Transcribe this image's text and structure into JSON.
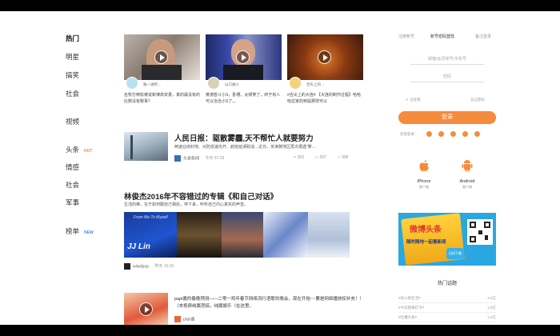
{
  "nav": {
    "items": [
      {
        "label": "热门",
        "tag": ""
      },
      {
        "label": "明星",
        "tag": ""
      },
      {
        "label": "搞笑",
        "tag": ""
      },
      {
        "label": "社会",
        "tag": ""
      },
      {
        "label": "视频",
        "tag": ""
      },
      {
        "label": "头条",
        "tag": "HOT"
      },
      {
        "label": "情感",
        "tag": ""
      },
      {
        "label": "社会",
        "tag": ""
      },
      {
        "label": "军事",
        "tag": ""
      },
      {
        "label": "榜单",
        "tag": "NEW"
      }
    ]
  },
  "videos": [
    {
      "author": "独一进积…",
      "title": "名牧打倒松被说新律高安書，真的最没有的比数没有致事？"
    },
    {
      "author": "山口通人",
      "title": "黄渤智斗小S，卧槽，太频笑了，终于有人可以治治小S了。。"
    },
    {
      "author": "舌尖上的…",
      "title": "#舌尖上的大连# 【大连的制作过程】哈哈哈拉家的到鼠那样可以"
    }
  ],
  "article1": {
    "title": "人民日报：驱散雾霾,天不帮忙人就要努力",
    "sub": "两速业绩封地、对防低速先开、航班延误取消…近日，京津冀地区再次遭遇“雾…",
    "source": "头条新闻",
    "time": "今天 07:29",
    "stats": [
      "359",
      "397",
      "998"
    ]
  },
  "article2": {
    "title": "林俊杰2016年不容错过的专辑《和自己对话》",
    "sub": "生活的难，在于如何跟自己相处，停下来，听听自己内心真实的声音。",
    "banner_text": "From Me To Myself",
    "banner_name": "JJ Lin",
    "source": "wilwilpop",
    "time": "昨天 16:33"
  },
  "article3": {
    "title": "papi酱的春晚预测——二零一鸡年春节网络流行语联欢晚会，现在开始~~要是网络播放权补充！！（本视频纯属恶搞，纯属娱乐（在这里。",
    "source": "papi酱"
  },
  "login": {
    "tabs": [
      "注册账号",
      "账号密码登陆",
      "备注登录"
    ],
    "username_placeholder": "邮箱/会员账号/手机号",
    "password_placeholder": "密码",
    "remember": "记住我",
    "forgot": "忘记密码",
    "button": "登录",
    "other_label": "其他登录："
  },
  "apps": [
    {
      "name": "iPhone",
      "sub": "客户端"
    },
    {
      "name": "Android",
      "sub": "客户端"
    }
  ],
  "ad": {
    "title": "微博头条",
    "line2": "随时随地一起看新闻",
    "qr_caption": "扫码下载"
  },
  "hot": {
    "title": "热门话题",
    "rows": [
      {
        "label": "#孙心悦生活#",
        "num": "4.5亿"
      },
      {
        "label": "#今日我来打卡#",
        "num": "1.9亿"
      },
      {
        "label": "#吐槽大会#",
        "num": "1.2亿"
      }
    ]
  },
  "colors": {
    "accent": "#f58b3c",
    "tag_new": "#4a90e2"
  }
}
